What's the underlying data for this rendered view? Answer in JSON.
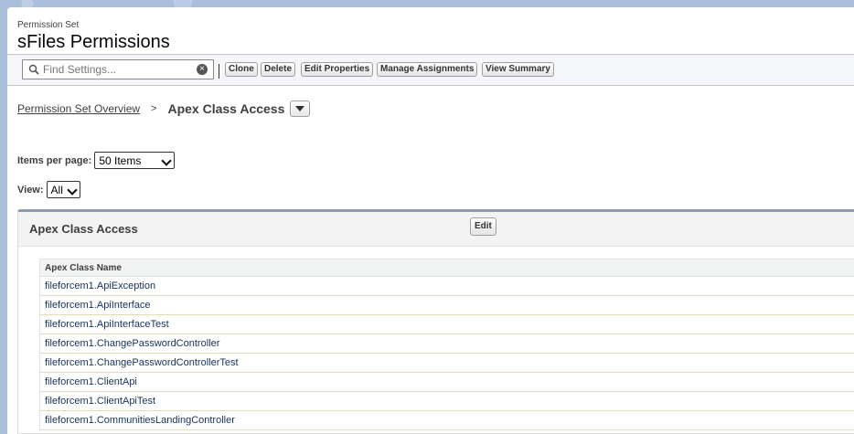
{
  "header": {
    "subtitle": "Permission Set",
    "title": "sFiles Permissions"
  },
  "toolbar": {
    "search_placeholder": "Find Settings...",
    "buttons": [
      "Clone",
      "Delete",
      "Edit Properties",
      "Manage Assignments",
      "View Summary"
    ]
  },
  "breadcrumb": {
    "link": "Permission Set Overview",
    "separator": ">",
    "current": "Apex Class Access"
  },
  "controls": {
    "items_per_page_label": "Items per page:",
    "items_per_page_value": "50 Items",
    "view_label": "View:",
    "view_value": "All"
  },
  "section": {
    "title": "Apex Class Access",
    "edit_label": "Edit",
    "column_header": "Apex Class Name",
    "rows": [
      "fileforcem1.ApiException",
      "fileforcem1.ApiInterface",
      "fileforcem1.ApiInterfaceTest",
      "fileforcem1.ChangePasswordController",
      "fileforcem1.ChangePasswordControllerTest",
      "fileforcem1.ClientApi",
      "fileforcem1.ClientApiTest",
      "fileforcem1.CommunitiesLandingController"
    ]
  },
  "icons": {
    "search": "search-icon",
    "clear": "clear-icon",
    "dropdown": "chevron-down-icon"
  }
}
